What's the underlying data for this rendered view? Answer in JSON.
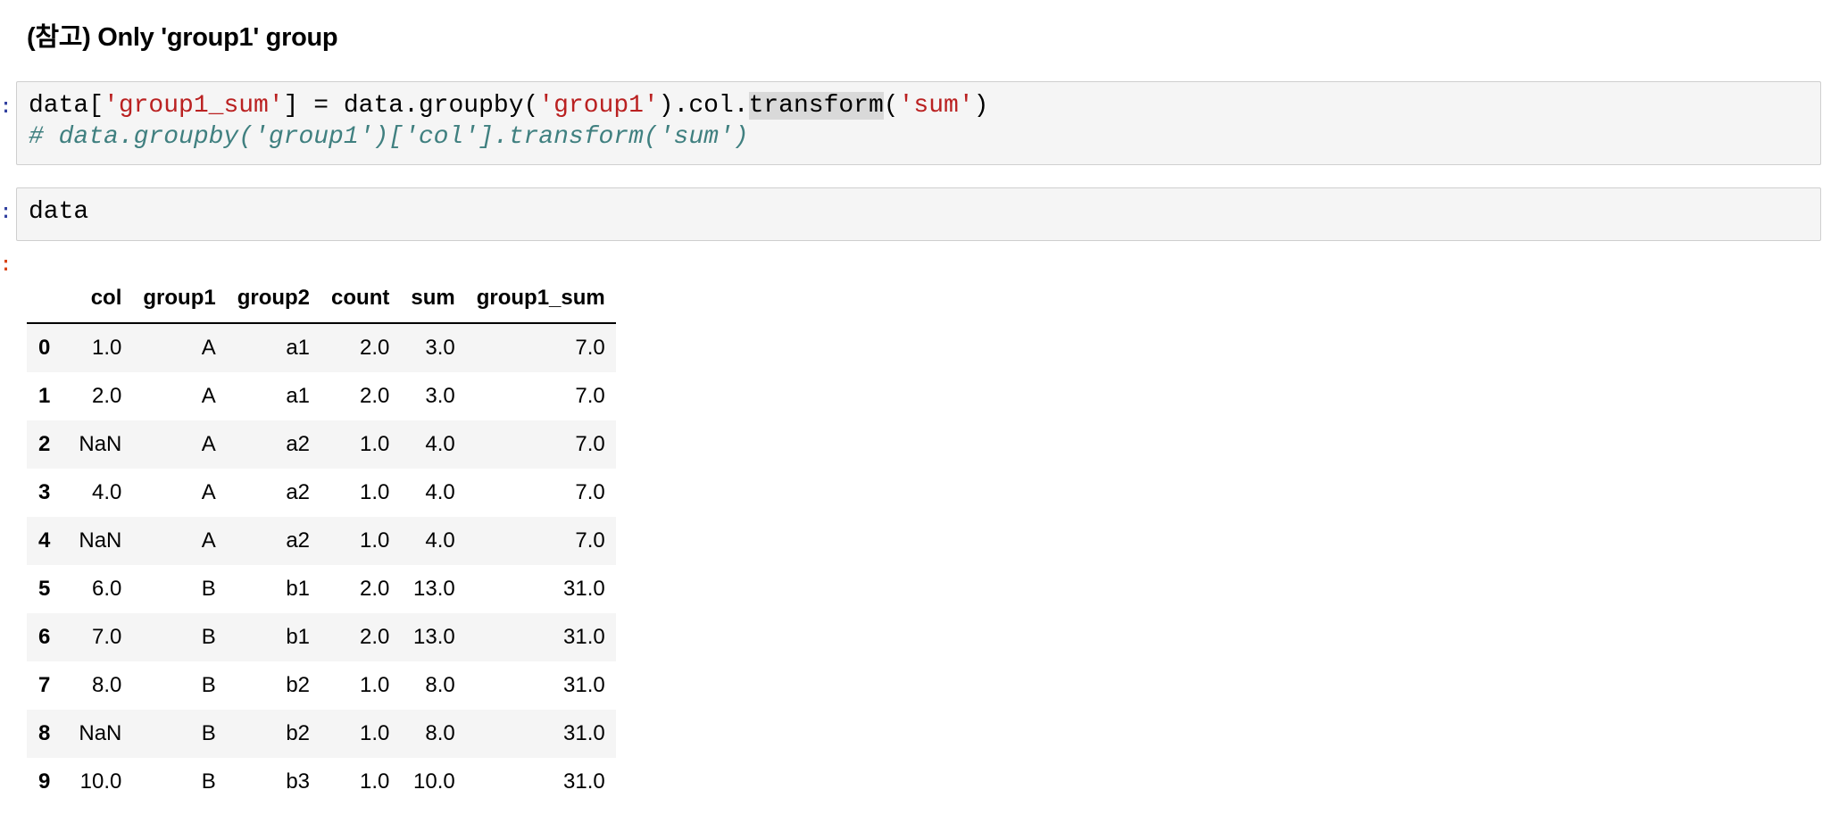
{
  "heading": "(참고) Only 'group1' group",
  "cells": {
    "code1": {
      "prompt": ":",
      "line1": {
        "p1": "data[",
        "s1": "'group1_sum'",
        "p2": "] = data.groupby(",
        "s2": "'group1'",
        "p3": ").col.",
        "hl": "transform",
        "p4": "(",
        "s3": "'sum'",
        "p5": ")"
      },
      "comment": "# data.groupby('group1')['col'].transform('sum')"
    },
    "code2": {
      "prompt": ":",
      "source": "data"
    },
    "output": {
      "prompt": ":"
    }
  },
  "table": {
    "columns": [
      "",
      "col",
      "group1",
      "group2",
      "count",
      "sum",
      "group1_sum"
    ],
    "rows": [
      [
        "0",
        "1.0",
        "A",
        "a1",
        "2.0",
        "3.0",
        "7.0"
      ],
      [
        "1",
        "2.0",
        "A",
        "a1",
        "2.0",
        "3.0",
        "7.0"
      ],
      [
        "2",
        "NaN",
        "A",
        "a2",
        "1.0",
        "4.0",
        "7.0"
      ],
      [
        "3",
        "4.0",
        "A",
        "a2",
        "1.0",
        "4.0",
        "7.0"
      ],
      [
        "4",
        "NaN",
        "A",
        "a2",
        "1.0",
        "4.0",
        "7.0"
      ],
      [
        "5",
        "6.0",
        "B",
        "b1",
        "2.0",
        "13.0",
        "31.0"
      ],
      [
        "6",
        "7.0",
        "B",
        "b1",
        "2.0",
        "13.0",
        "31.0"
      ],
      [
        "7",
        "8.0",
        "B",
        "b2",
        "1.0",
        "8.0",
        "31.0"
      ],
      [
        "8",
        "NaN",
        "B",
        "b2",
        "1.0",
        "8.0",
        "31.0"
      ],
      [
        "9",
        "10.0",
        "B",
        "b3",
        "1.0",
        "10.0",
        "31.0"
      ]
    ]
  }
}
